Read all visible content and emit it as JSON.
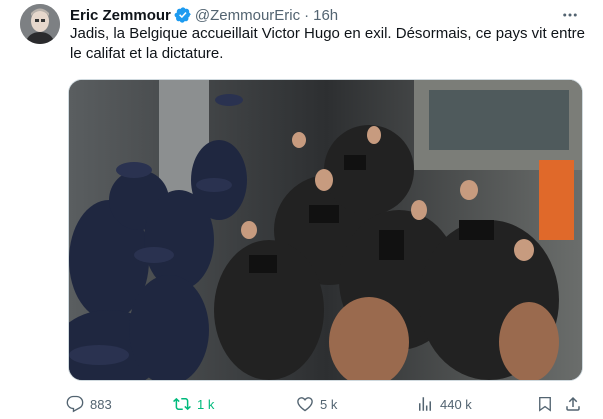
{
  "tweet": {
    "author_name": "Eric Zemmour",
    "handle": "@ZemmourEric",
    "separator": "·",
    "time": "16h",
    "text": "Jadis, la Belgique accueillait Victor Hugo en exil. Désormais, ce pays vit entre le califat et la dictature.",
    "media_alt": "Press scrum photo",
    "verified_color": "#1d9bf0"
  },
  "actions": {
    "replies": "883",
    "reposts": "1 k",
    "likes": "5 k",
    "views": "440 k",
    "repost_color": "#00ba7c"
  },
  "icons": [
    "more-icon",
    "verified-icon",
    "reply-icon",
    "repost-icon",
    "like-icon",
    "views-icon",
    "bookmark-icon",
    "share-icon"
  ]
}
